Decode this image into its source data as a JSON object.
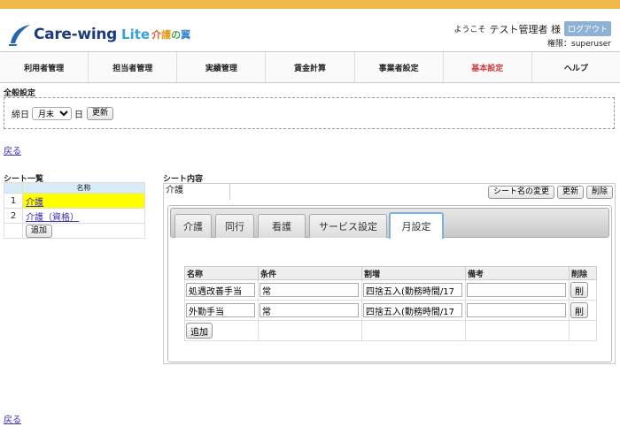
{
  "header": {
    "logo_text": "Care-wing",
    "logo_lite": "Lite",
    "logo_jp": "介護の翼",
    "welcome": "ようこそ",
    "user": "テスト管理者 様",
    "logout": "ログアウト",
    "permission": "権限：superuser"
  },
  "nav": {
    "items": [
      "利用者管理",
      "担当者管理",
      "実績管理",
      "賃金計算",
      "事業者設定",
      "基本設定",
      "ヘルプ"
    ]
  },
  "general": {
    "title": "全般設定",
    "closing_label": "締日",
    "closing_value": "月末",
    "day_suffix": "日",
    "update": "更新"
  },
  "back_link": "戻る",
  "sheet_list": {
    "title": "シート一覧",
    "header_name": "名称",
    "rows": [
      {
        "num": "1",
        "name": "介護"
      },
      {
        "num": "2",
        "name": "介護（資格）"
      }
    ],
    "add": "追加"
  },
  "sheet_content": {
    "title": "シート内容",
    "sheet_name": "介護",
    "rename": "シート名の変更",
    "update": "更新",
    "delete": "削除",
    "tabs": [
      "介護",
      "同行",
      "看護",
      "サービス設定",
      "月設定"
    ],
    "columns": [
      "名称",
      "条件",
      "割増",
      "備考",
      "削除"
    ],
    "rows": [
      {
        "name": "処遇改善手当",
        "condition": "常",
        "premium": "四捨五入(勤務時間/17",
        "note": "",
        "del": "削"
      },
      {
        "name": "外勤手当",
        "condition": "常",
        "premium": "四捨五入(勤務時間/17",
        "note": "",
        "del": "削"
      }
    ],
    "add": "追加"
  },
  "colors": {
    "topbar": "#f0b94a",
    "active_nav": "#d23a3a",
    "highlight": "#ffff00",
    "link": "#3a2fb0"
  }
}
